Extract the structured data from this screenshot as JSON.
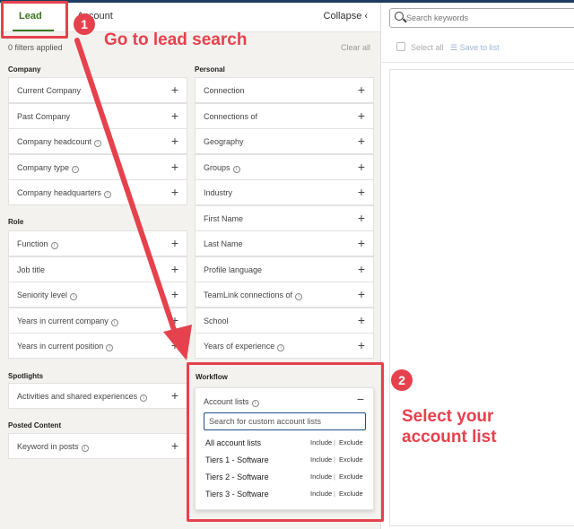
{
  "tabs": {
    "lead": "Lead",
    "account": "Account",
    "collapse": "Collapse"
  },
  "filters_applied": "0 filters applied",
  "clear_all": "Clear all",
  "sections": {
    "company": {
      "title": "Company",
      "items": [
        "Current Company",
        "Past Company",
        "Company headcount",
        "Company type",
        "Company headquarters"
      ]
    },
    "role": {
      "title": "Role",
      "items": [
        "Function",
        "Job title",
        "Seniority level",
        "Years in current company",
        "Years in current position"
      ]
    },
    "spotlights": {
      "title": "Spotlights",
      "items": [
        "Activities and shared experiences"
      ]
    },
    "posted_content": {
      "title": "Posted Content",
      "items": [
        "Keyword in posts"
      ]
    },
    "personal": {
      "title": "Personal",
      "items": [
        "Connection",
        "Connections of",
        "Geography",
        "Groups",
        "Industry",
        "First Name",
        "Last Name",
        "Profile language",
        "TeamLink connections of",
        "School",
        "Years of experience"
      ]
    },
    "workflow": {
      "title": "Workflow"
    }
  },
  "account_lists": {
    "label": "Account lists",
    "search_placeholder": "Search for custom account lists",
    "options": [
      {
        "name": "All account lists",
        "include": "Include",
        "exclude": "Exclude"
      },
      {
        "name": "Tiers 1 - Software",
        "include": "Include",
        "exclude": "Exclude"
      },
      {
        "name": "Tiers 2 - Software",
        "include": "Include",
        "exclude": "Exclude"
      },
      {
        "name": "Tiers 3 - Software",
        "include": "Include",
        "exclude": "Exclude"
      }
    ]
  },
  "right_panel": {
    "search_placeholder": "Search keywords",
    "select_all": "Select all",
    "save_to_list": "Save to list"
  },
  "annotations": {
    "step1_number": "1",
    "step1_text": "Go to lead search",
    "step2_number": "2",
    "step2_text_line1": "Select your",
    "step2_text_line2": "account list",
    "accent_color": "#e5424d"
  },
  "colors": {
    "lead_green": "#38761d",
    "focus_blue": "#1f4e8c",
    "panel_bg": "#f3f2ef"
  }
}
